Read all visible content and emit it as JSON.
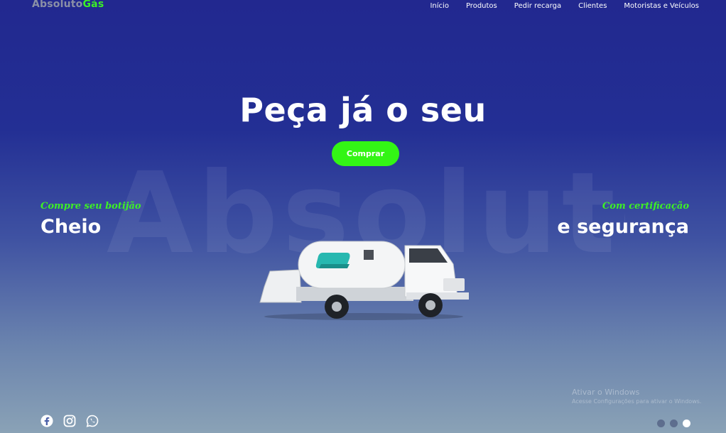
{
  "brand": {
    "part1": "Absoluto",
    "part2": "Gás"
  },
  "nav": {
    "items": [
      {
        "label": "Início"
      },
      {
        "label": "Produtos"
      },
      {
        "label": "Pedir recarga"
      },
      {
        "label": "Clientes"
      },
      {
        "label": "Motoristas e Veículos"
      }
    ]
  },
  "hero": {
    "title": "Peça já o seu",
    "button_label": "Comprar",
    "background_word": "Absoluto",
    "left": {
      "kicker": "Compre seu botijão",
      "heading": "Cheio"
    },
    "right": {
      "kicker": "Com certificação",
      "heading": "e segurança"
    }
  },
  "watermark": {
    "line1": "Ativar o Windows",
    "line2": "Acesse Configurações para ativar o Windows."
  },
  "social": [
    "facebook-icon",
    "instagram-icon",
    "whatsapp-icon"
  ],
  "carousel": {
    "slides": 3,
    "active_slide": 3
  },
  "colors": {
    "accent": "#33f515",
    "background_top": "#22288f",
    "background_bottom": "#8aa2b6"
  }
}
